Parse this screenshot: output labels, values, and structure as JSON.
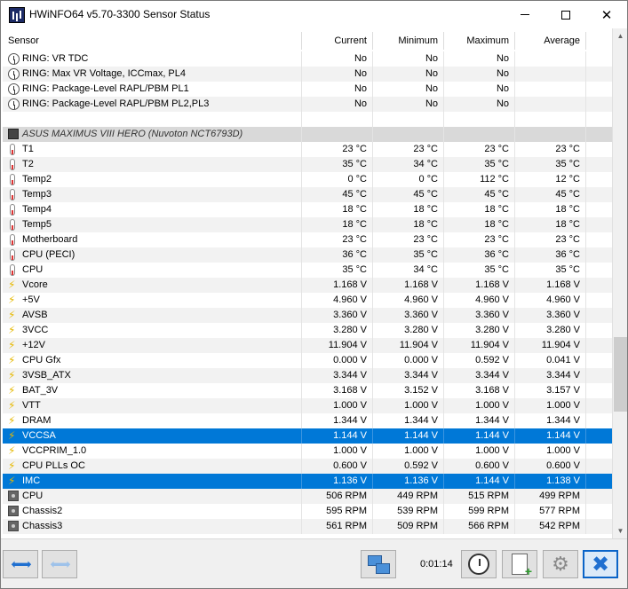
{
  "window": {
    "title": "HWiNFO64 v5.70-3300 Sensor Status"
  },
  "columns": {
    "sensor": "Sensor",
    "current": "Current",
    "minimum": "Minimum",
    "maximum": "Maximum",
    "average": "Average"
  },
  "rows": [
    {
      "type": "flag",
      "icon": "clock",
      "name": "RING: VR TDC",
      "cur": "No",
      "min": "No",
      "max": "No",
      "avg": ""
    },
    {
      "type": "flag",
      "icon": "clock",
      "name": "RING: Max VR Voltage, ICCmax, PL4",
      "cur": "No",
      "min": "No",
      "max": "No",
      "avg": ""
    },
    {
      "type": "flag",
      "icon": "clock",
      "name": "RING: Package-Level RAPL/PBM PL1",
      "cur": "No",
      "min": "No",
      "max": "No",
      "avg": ""
    },
    {
      "type": "flag",
      "icon": "clock",
      "name": "RING: Package-Level RAPL/PBM PL2,PL3",
      "cur": "No",
      "min": "No",
      "max": "No",
      "avg": ""
    },
    {
      "type": "blank",
      "name": "",
      "cur": "",
      "min": "",
      "max": "",
      "avg": ""
    },
    {
      "type": "group",
      "icon": "chip",
      "name": "ASUS MAXIMUS VIII HERO (Nuvoton NCT6793D)",
      "cur": "",
      "min": "",
      "max": "",
      "avg": ""
    },
    {
      "type": "temp",
      "icon": "therm",
      "name": "T1",
      "cur": "23 °C",
      "min": "23 °C",
      "max": "23 °C",
      "avg": "23 °C"
    },
    {
      "type": "temp",
      "icon": "therm",
      "name": "T2",
      "cur": "35 °C",
      "min": "34 °C",
      "max": "35 °C",
      "avg": "35 °C"
    },
    {
      "type": "temp",
      "icon": "therm",
      "name": "Temp2",
      "cur": "0 °C",
      "min": "0 °C",
      "max": "112 °C",
      "avg": "12 °C"
    },
    {
      "type": "temp",
      "icon": "therm",
      "name": "Temp3",
      "cur": "45 °C",
      "min": "45 °C",
      "max": "45 °C",
      "avg": "45 °C"
    },
    {
      "type": "temp",
      "icon": "therm",
      "name": "Temp4",
      "cur": "18 °C",
      "min": "18 °C",
      "max": "18 °C",
      "avg": "18 °C"
    },
    {
      "type": "temp",
      "icon": "therm",
      "name": "Temp5",
      "cur": "18 °C",
      "min": "18 °C",
      "max": "18 °C",
      "avg": "18 °C"
    },
    {
      "type": "temp",
      "icon": "therm",
      "name": "Motherboard",
      "cur": "23 °C",
      "min": "23 °C",
      "max": "23 °C",
      "avg": "23 °C"
    },
    {
      "type": "temp",
      "icon": "therm",
      "name": "CPU (PECI)",
      "cur": "36 °C",
      "min": "35 °C",
      "max": "36 °C",
      "avg": "36 °C"
    },
    {
      "type": "temp",
      "icon": "therm",
      "name": "CPU",
      "cur": "35 °C",
      "min": "34 °C",
      "max": "35 °C",
      "avg": "35 °C"
    },
    {
      "type": "volt",
      "icon": "volt",
      "name": "Vcore",
      "cur": "1.168 V",
      "min": "1.168 V",
      "max": "1.168 V",
      "avg": "1.168 V"
    },
    {
      "type": "volt",
      "icon": "volt",
      "name": "+5V",
      "cur": "4.960 V",
      "min": "4.960 V",
      "max": "4.960 V",
      "avg": "4.960 V"
    },
    {
      "type": "volt",
      "icon": "volt",
      "name": "AVSB",
      "cur": "3.360 V",
      "min": "3.360 V",
      "max": "3.360 V",
      "avg": "3.360 V"
    },
    {
      "type": "volt",
      "icon": "volt",
      "name": "3VCC",
      "cur": "3.280 V",
      "min": "3.280 V",
      "max": "3.280 V",
      "avg": "3.280 V"
    },
    {
      "type": "volt",
      "icon": "volt",
      "name": "+12V",
      "cur": "11.904 V",
      "min": "11.904 V",
      "max": "11.904 V",
      "avg": "11.904 V"
    },
    {
      "type": "volt",
      "icon": "volt",
      "name": "CPU Gfx",
      "cur": "0.000 V",
      "min": "0.000 V",
      "max": "0.592 V",
      "avg": "0.041 V"
    },
    {
      "type": "volt",
      "icon": "volt",
      "name": "3VSB_ATX",
      "cur": "3.344 V",
      "min": "3.344 V",
      "max": "3.344 V",
      "avg": "3.344 V"
    },
    {
      "type": "volt",
      "icon": "volt",
      "name": "BAT_3V",
      "cur": "3.168 V",
      "min": "3.152 V",
      "max": "3.168 V",
      "avg": "3.157 V"
    },
    {
      "type": "volt",
      "icon": "volt",
      "name": "VTT",
      "cur": "1.000 V",
      "min": "1.000 V",
      "max": "1.000 V",
      "avg": "1.000 V"
    },
    {
      "type": "volt",
      "icon": "volt",
      "name": "DRAM",
      "cur": "1.344 V",
      "min": "1.344 V",
      "max": "1.344 V",
      "avg": "1.344 V"
    },
    {
      "type": "volt",
      "icon": "volt",
      "name": "VCCSA",
      "cur": "1.144 V",
      "min": "1.144 V",
      "max": "1.144 V",
      "avg": "1.144 V",
      "selected": true
    },
    {
      "type": "volt",
      "icon": "volt",
      "name": "VCCPRIM_1.0",
      "cur": "1.000 V",
      "min": "1.000 V",
      "max": "1.000 V",
      "avg": "1.000 V"
    },
    {
      "type": "volt",
      "icon": "volt",
      "name": "CPU PLLs OC",
      "cur": "0.600 V",
      "min": "0.592 V",
      "max": "0.600 V",
      "avg": "0.600 V"
    },
    {
      "type": "volt",
      "icon": "volt",
      "name": "IMC",
      "cur": "1.136 V",
      "min": "1.136 V",
      "max": "1.144 V",
      "avg": "1.138 V",
      "selected": true
    },
    {
      "type": "fan",
      "icon": "fan",
      "name": "CPU",
      "cur": "506 RPM",
      "min": "449 RPM",
      "max": "515 RPM",
      "avg": "499 RPM"
    },
    {
      "type": "fan",
      "icon": "fan",
      "name": "Chassis2",
      "cur": "595 RPM",
      "min": "539 RPM",
      "max": "599 RPM",
      "avg": "577 RPM"
    },
    {
      "type": "fan",
      "icon": "fan",
      "name": "Chassis3",
      "cur": "561 RPM",
      "min": "509 RPM",
      "max": "566 RPM",
      "avg": "542 RPM"
    }
  ],
  "toolbar": {
    "elapsed_time": "0:01:14"
  },
  "icons": {
    "app": "hwinfo-app-icon",
    "nav_forward_back": "arrows-icon",
    "network": "network-icon",
    "clock": "clock-icon",
    "report": "add-report-icon",
    "settings": "gear-icon",
    "close": "x-icon"
  },
  "colors": {
    "selection": "#0078d7",
    "group_row": "#d9d9d9",
    "alt_row": "#f2f2f2",
    "accent": "#1f6fd0"
  }
}
